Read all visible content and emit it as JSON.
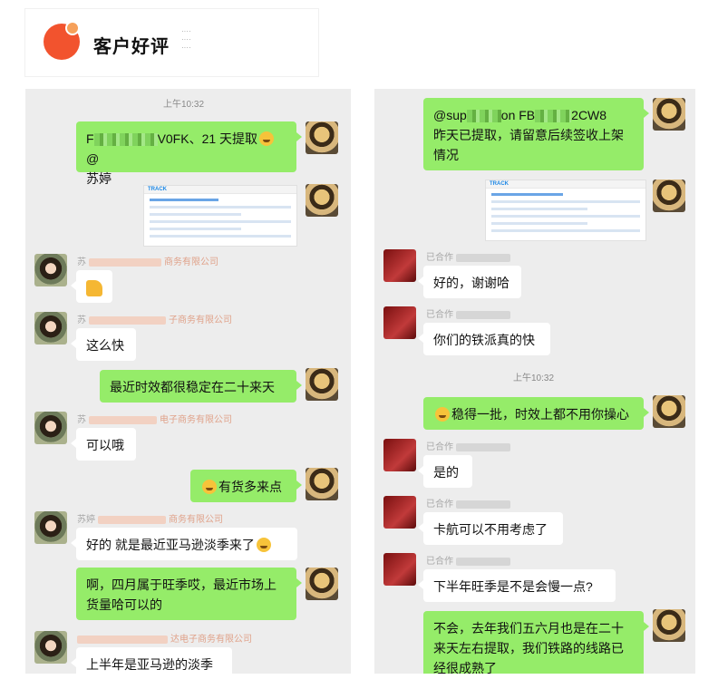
{
  "header": {
    "title": "客户好评"
  },
  "left_chat": {
    "time": "上午10:32",
    "messages": {
      "m1_pre": "F",
      "m1_mid": "V0FK、21 天提取",
      "m1_mention": "@",
      "m1_line2": "苏婷",
      "img_brand": "TRACK",
      "n1_name": "苏",
      "n1_org": "商务有限公司",
      "n2_name": "苏",
      "n2_org": "子商务有限公司",
      "m3": "这么快",
      "m4": "最近时效都很稳定在二十来天",
      "n3_name": "苏",
      "n3_org": "电子商务有限公司",
      "m5": "可以哦",
      "m6": "有货多来点",
      "n4_name": "苏婷",
      "n4_org": "商务有限公司",
      "m7": "好的 就是最近亚马逊淡季来了",
      "m8_l1": "啊，四月属于旺季哎，最近市场上",
      "m8_l2": "货量哈可以的",
      "n5_org": "达电子商务有限公司",
      "m9": "上半年是亚马逊的淡季"
    }
  },
  "right_chat": {
    "time": "上午10:32",
    "messages": {
      "r1_pre": "@sup",
      "r1_mid": "on FB",
      "r1_end": "2CW8",
      "r1_l2": "昨天已提取，请留意后续签收上架",
      "r1_l3": "情况",
      "img_brand": "TRACK",
      "n1_name": "已合作",
      "r2": "好的，谢谢哈",
      "n2_name": "已合作",
      "r3": "你们的铁派真的快",
      "r4": "稳得一批，时效上都不用你操心",
      "n3_name": "已合作",
      "r5": "是的",
      "n4_name": "已合作",
      "r6": "卡航可以不用考虑了",
      "n5_name": "已合作",
      "r7": "下半年旺季是不是会慢一点?",
      "r8_l1": "不会，去年我们五六月也是在二十",
      "r8_l2": "来天左右提取，我们铁路的线路已",
      "r8_l3": "经很成熟了"
    }
  },
  "colors": {
    "self_bubble": "#95ec69",
    "other_bubble": "#ffffff",
    "chat_bg": "#ededed",
    "logo": "#f2532e"
  }
}
